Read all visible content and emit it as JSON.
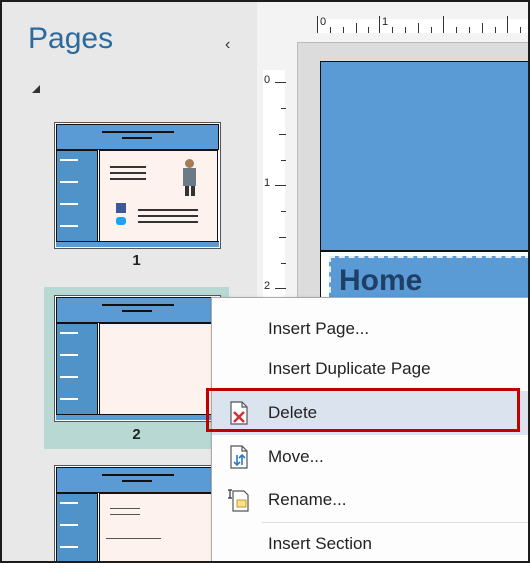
{
  "pane": {
    "title": "Pages",
    "collapse_glyph": "‹",
    "thumbnails": [
      {
        "page_number": "1"
      },
      {
        "page_number": "2"
      },
      {
        "page_number": ""
      }
    ]
  },
  "ruler": {
    "top_numbers": [
      "0",
      "1"
    ],
    "left_numbers": [
      "0",
      "1",
      "2"
    ]
  },
  "canvas": {
    "heading": "Home"
  },
  "context_menu": {
    "items": [
      {
        "label": "Insert Page...",
        "icon": ""
      },
      {
        "label": "Insert Duplicate Page",
        "icon": ""
      },
      {
        "label": "Delete",
        "icon": "delete-page-icon"
      },
      {
        "label": "Move...",
        "icon": "move-page-icon"
      },
      {
        "label": "Rename...",
        "icon": "rename-page-icon"
      },
      {
        "label": "Insert Section",
        "icon": ""
      }
    ],
    "highlighted": "Delete"
  },
  "colors": {
    "accent": "#5b9bd5",
    "title": "#2b6a9f",
    "selection": "#b7d8d3",
    "callout": "#c00000"
  }
}
